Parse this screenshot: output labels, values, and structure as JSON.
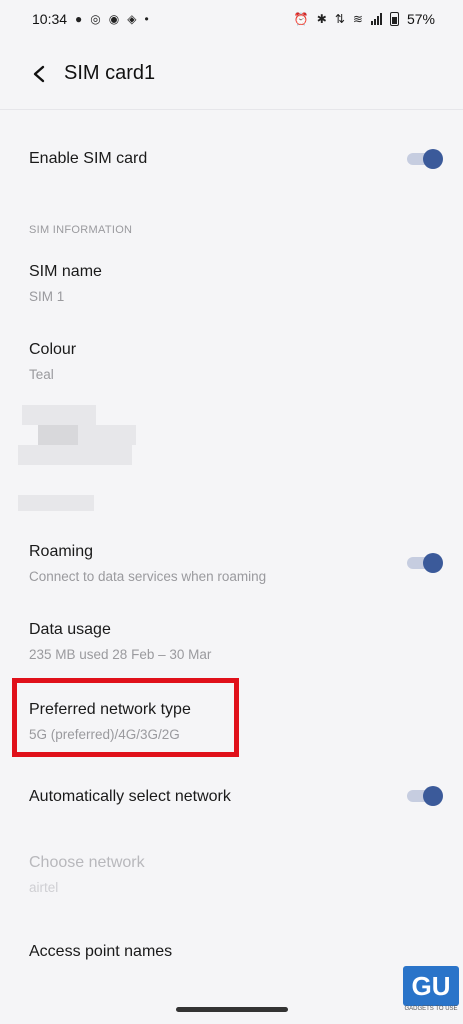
{
  "status_bar": {
    "time": "10:34",
    "notification_icons": [
      "chat-bubble-icon",
      "instagram-icon",
      "messenger-icon",
      "location-pin-icon",
      "dot-icon"
    ],
    "system_icons": [
      "alarm-icon",
      "bluetooth-icon",
      "lte-icon",
      "wifi-icon",
      "signal-icon",
      "battery-icon"
    ],
    "battery_percent": "57%"
  },
  "header": {
    "title": "SIM card1"
  },
  "enable_sim": {
    "label": "Enable SIM card",
    "enabled": true
  },
  "sim_info": {
    "section_label": "SIM INFORMATION",
    "sim_name": {
      "label": "SIM name",
      "value": "SIM 1"
    },
    "colour": {
      "label": "Colour",
      "value": "Teal"
    }
  },
  "roaming": {
    "label": "Roaming",
    "sub": "Connect to data services when roaming",
    "enabled": true
  },
  "data_usage": {
    "label": "Data usage",
    "sub": "235 MB used 28 Feb – 30 Mar"
  },
  "preferred_network": {
    "label": "Preferred network type",
    "sub": "5G (preferred)/4G/3G/2G"
  },
  "auto_network": {
    "label": "Automatically select network",
    "enabled": true
  },
  "choose_network": {
    "label": "Choose network",
    "sub": "airtel"
  },
  "apn": {
    "label": "Access point names"
  },
  "colors": {
    "accent": "#3b5a9a",
    "track": "#c6cde0",
    "highlight": "#e0101a"
  },
  "watermark": {
    "text": "GU",
    "caption": "GADGETS TO USE"
  }
}
